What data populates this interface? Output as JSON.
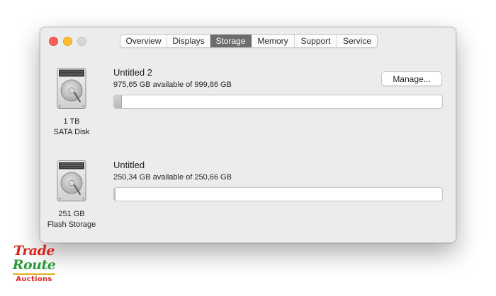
{
  "window": {
    "tabs": [
      {
        "label": "Overview"
      },
      {
        "label": "Displays"
      },
      {
        "label": "Storage",
        "active": true
      },
      {
        "label": "Memory"
      },
      {
        "label": "Support"
      },
      {
        "label": "Service"
      }
    ]
  },
  "disks": [
    {
      "icon": "hard-drive-icon",
      "caption_line1": "1 TB",
      "caption_line2": "SATA Disk",
      "volume_name": "Untitled 2",
      "available_text": "975,65 GB available of 999,86 GB",
      "used_fraction": 0.024
    },
    {
      "icon": "hard-drive-icon",
      "caption_line1": "251 GB",
      "caption_line2": "Flash Storage",
      "volume_name": "Untitled",
      "available_text": "250,34 GB available of 250,66 GB",
      "used_fraction": 0.0013
    }
  ],
  "actions": {
    "manage_label": "Manage..."
  },
  "watermark": {
    "line1": "Trade",
    "line2": "Route",
    "line3": "Auctions"
  },
  "colors": {
    "close": "#fe5f57",
    "minimize": "#febc2e",
    "zoom_disabled": "#d7d7d7",
    "tab_active": "#6c6c6c",
    "window_bg": "#ececec"
  }
}
